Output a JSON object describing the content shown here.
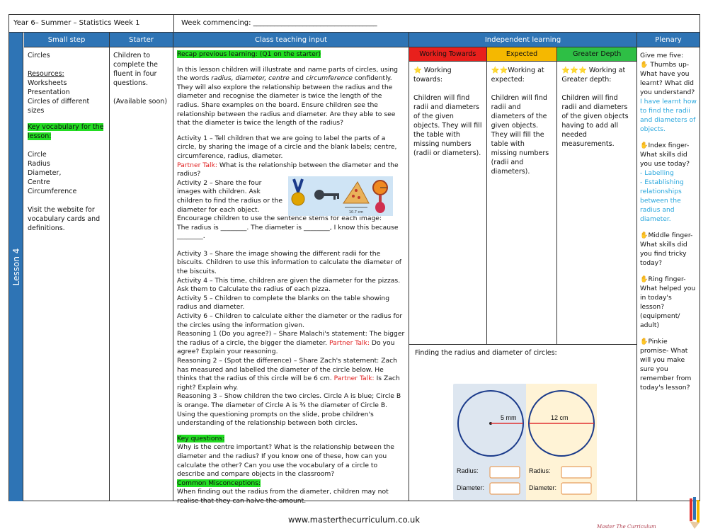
{
  "header": {
    "left": "Year 6– Summer – Statistics  Week 1",
    "right": "Week commencing: ___________________________________"
  },
  "lesson_label": "Lesson 4",
  "columns": {
    "small_step": "Small step",
    "starter": "Starter",
    "class_teaching": "Class teaching input",
    "independent": "Independent learning",
    "plenary": "Plenary"
  },
  "small_step": {
    "title": "Circles",
    "resources_label": "Resources:",
    "resources": [
      "Worksheets",
      "Presentation",
      "Circles of different sizes"
    ],
    "key_vocab_label": "Key vocabulary for the lesson:",
    "vocab": [
      "Circle",
      "Radius",
      "Diameter,",
      "Centre",
      "Circumference"
    ],
    "website_note": "Visit the website for vocabulary cards and definitions."
  },
  "starter": {
    "text": "Children to complete the fluent in four questions.",
    "available": "(Available soon)"
  },
  "class_teaching": {
    "recap": "Recap previous learning: (Q1 on the starter)",
    "intro_1": "In this lesson children will illustrate and name parts of circles, using the words ",
    "intro_words": "radius, diameter, centre",
    "intro_and": " and ",
    "intro_word2": "circumference",
    "intro_2": " confidently. They will also explore the relationship between the radius and the diameter and recognise the diameter is twice the length of the radius. Share examples on the board. Ensure children see the relationship between the radius and diameter. Are they able to see that the diameter is twice the length of the radius?",
    "activity1": "Activity 1 – Tell children that we are going to label the parts of a circle, by sharing the image of a circle and the blank labels; centre, circumference, radius, diameter.",
    "partner1_label": "Partner Talk:",
    "partner1_text": " What is the relationship between the diameter and the radius?",
    "activity2": "Activity 2 – Share the four images with children. Ask children to find the radius or the diameter for each object.",
    "encourage": "Encourage children to use the sentence stems for each image:",
    "stem": "The radius is ________. The diameter is ________, I know this because ________.",
    "pizza_label": "10.7 cm",
    "activity3": "Activity 3 – Share the image showing the different radii for the biscuits. Children to use this information to calculate the diameter of the biscuits.",
    "activity4": "Activity 4 – This time, children are given the diameter for the pizzas. Ask them to Calculate the radius of each pizza.",
    "activity5": "Activity 5 – Children to complete the blanks on the table showing radius and diameter.",
    "activity6": "Activity 6 – Children to calculate either the diameter or the radius for the circles using the information given.",
    "reasoning1": "Reasoning 1 (Do you agree?) – Share Malachi's statement: The bigger the radius of a circle, the bigger the diameter. ",
    "reasoning1_pt": "Partner Talk:",
    "reasoning1_end": " Do you agree? Explain your reasoning.",
    "reasoning2": "Reasoning 2 – (Spot the difference) – Share Zach's statement: Zach has measured and labelled the diameter of the circle below. He thinks that the radius of this circle will be 6 cm. ",
    "reasoning2_pt": "Partner Talk:",
    "reasoning2_end": " Is Zach right? Explain why.",
    "reasoning3": "Reasoning 3 – Show children the two circles. Circle A is blue; Circle B is orange. The diameter of Circle A is ¾ the diameter of Circle B.",
    "prompts": "Using the questioning prompts on the slide, probe children's understanding of the relationship between both circles.",
    "key_q_label": "Key questions:",
    "key_q": "Why is the centre important? What is the relationship between the diameter and the radius? If you know one of these, how can you calculate the other? Can you use the vocabulary of a circle to describe and compare objects in the classroom?",
    "misconceptions_label": "Common Misconceptions:",
    "misconceptions": "When finding out the radius from the diameter, children may not realise that they can halve the amount."
  },
  "independent": {
    "wt_label": "Working Towards",
    "ex_label": "Expected",
    "gd_label": "Greater Depth",
    "wt_title": "Working towards:",
    "ex_title": "Working at expected:",
    "gd_title": "Working at Greater depth:",
    "wt_stars": "⭐",
    "ex_stars": "⭐⭐",
    "gd_stars": "⭐⭐⭐",
    "wt_text": "Children will find radii and diameters of the given objects. They will fill the table with missing numbers (radii or diameters).",
    "ex_text": "Children will find radii and diameters of the given objects. They will fill the table with missing numbers (radii and diameters).",
    "gd_text": "Children will find radii and diameters of the given objects having to add all needed measurements.",
    "finding_title": "Finding the radius and diameter of circles:",
    "circle_a_label": "5 mm",
    "circle_b_label": "12 cm",
    "radius_label": "Radius:",
    "diameter_label": "Diameter:"
  },
  "plenary": {
    "intro": "Give me five:",
    "thumb": " Thumbs up- What have you learnt? What did you understand?",
    "thumb_blue": "I have learnt how to find the radii and diameters of objects.",
    "index": "Index finger- What skills did you use today?",
    "index_blue1": "- Labelling",
    "index_blue2": "- Establishing relationships between the radius and diameter.",
    "middle": "Middle finger- What skills did you find tricky today?",
    "ring": "Ring finger- What helped you in today's lesson? (equipment/ adult)",
    "pinkie": "Pinkie promise- What will you make sure you remember from today's lesson?"
  },
  "footer": "www.masterthecurriculum.co.uk",
  "signature": "Master The Curriculum",
  "colors": {
    "blue": "#2e74b5",
    "wt": "#e8201c",
    "ex": "#f5b800",
    "gd": "#2ebf45",
    "highlight": "#22dd22"
  }
}
